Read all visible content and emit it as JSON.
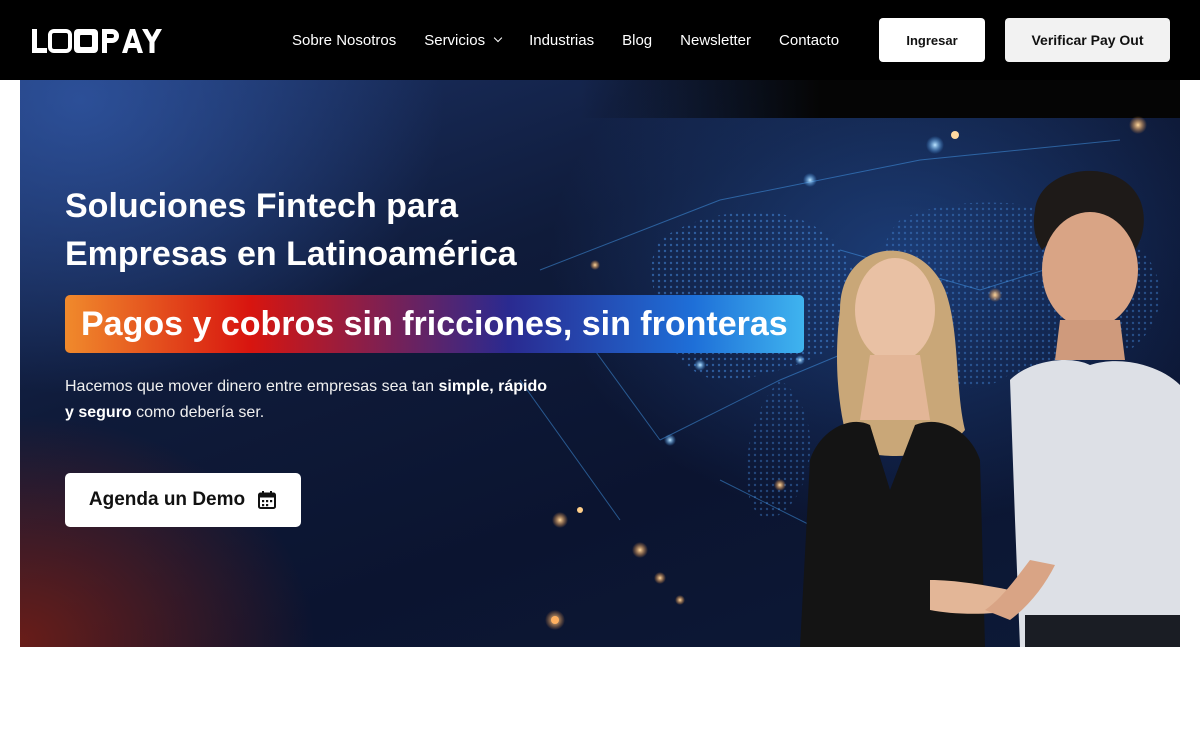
{
  "header": {
    "logo_text": "LOOPAY",
    "nav": [
      {
        "label": "Sobre Nosotros"
      },
      {
        "label": "Servicios"
      },
      {
        "label": "Industrias"
      },
      {
        "label": "Blog"
      },
      {
        "label": "Newsletter"
      },
      {
        "label": "Contacto"
      }
    ],
    "login_label": "Ingresar",
    "verify_label": "Verificar Pay Out"
  },
  "hero": {
    "title_line1": "Soluciones Fintech para",
    "title_line2": "Empresas en Latinoamérica",
    "highlight": "Pagos y cobros sin fricciones, sin fronteras",
    "desc_part1": "Hacemos que mover dinero entre empresas sea tan ",
    "desc_bold1": "simple, rápido",
    "desc_bold2": "y seguro",
    "desc_part2": " como debería ser.",
    "cta_label": "Agenda un Demo",
    "cta_icon": "calendar-icon"
  },
  "colors": {
    "header_bg": "#000000",
    "hero_bg": "#0f1b3a",
    "pill_orange": "#f08a2c",
    "pill_red": "#d8150f",
    "pill_blue": "#1e6fd8",
    "pill_cyan": "#3fb4ef"
  }
}
